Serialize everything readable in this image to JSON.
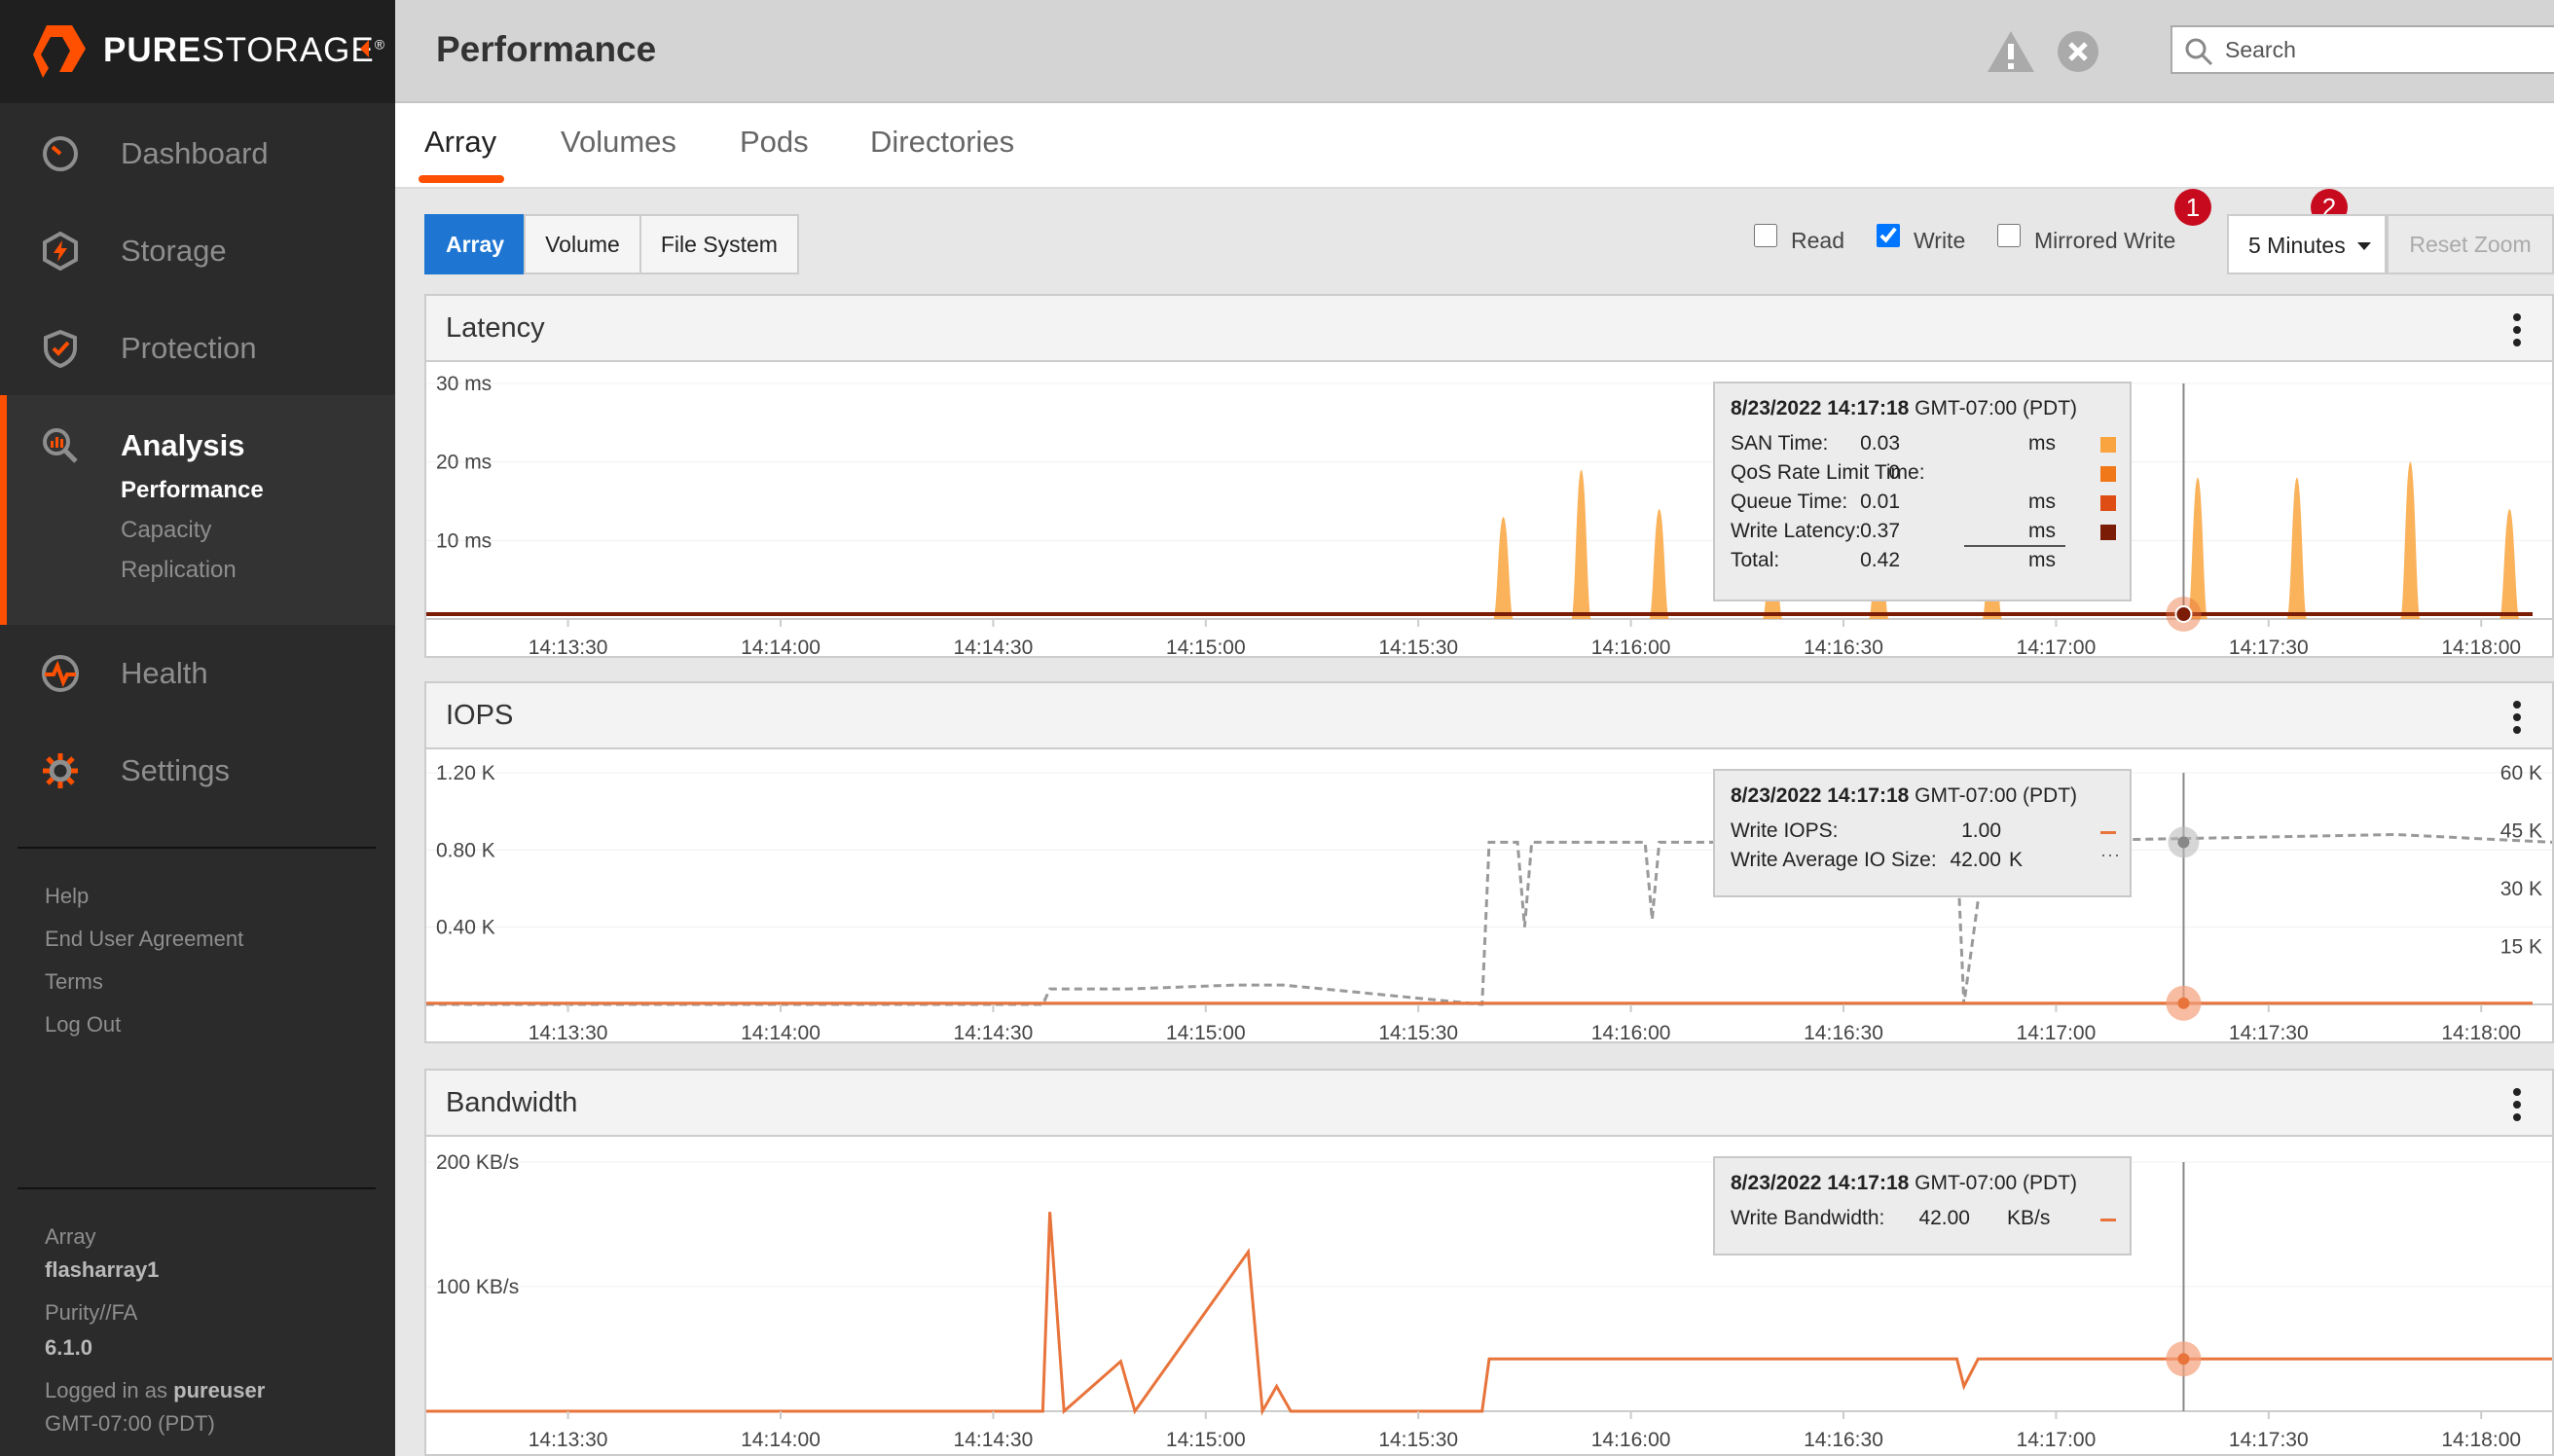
{
  "brand": {
    "name_bold": "PURE",
    "name_regular": "STORAGE",
    "mark": "®"
  },
  "sidebar": {
    "nav": {
      "dashboard": "Dashboard",
      "storage": "Storage",
      "protection": "Protection",
      "analysis": "Analysis",
      "health": "Health",
      "settings": "Settings"
    },
    "analysis_sub": {
      "performance": "Performance",
      "capacity": "Capacity",
      "replication": "Replication"
    },
    "footer_links": {
      "help": "Help",
      "eua": "End User Agreement",
      "terms": "Terms",
      "logout": "Log Out"
    },
    "info": {
      "array_label": "Array",
      "array_name": "flasharray1",
      "purity_label": "Purity//FA",
      "purity_version": "6.1.0",
      "logged_in_prefix": "Logged in as",
      "user": "pureuser",
      "timezone": "GMT-07:00 (PDT)"
    }
  },
  "header": {
    "title": "Performance",
    "search_placeholder": "Search"
  },
  "tabs": {
    "array": "Array",
    "volumes": "Volumes",
    "pods": "Pods",
    "directories": "Directories"
  },
  "toolbar": {
    "seg": {
      "array": "Array",
      "volume": "Volume",
      "filesystem": "File System"
    },
    "read_label": "Read",
    "write_label": "Write",
    "mirrored_label": "Mirrored Write",
    "badge1": "1",
    "badge2": "2",
    "read_checked": false,
    "write_checked": true,
    "mirrored_checked": false,
    "time_range": "5 Minutes",
    "reset_zoom": "Reset Zoom"
  },
  "colors": {
    "accent": "#fe5000",
    "san": "#f9a43e",
    "qos": "#f07818",
    "queue": "#dd4d14",
    "write_latency": "#7a1c06",
    "series_line": "#e8743b",
    "active_button": "#1f76d2",
    "badge": "#c80a1e"
  },
  "x_ticks": [
    "14:13:30",
    "14:14:00",
    "14:14:30",
    "14:15:00",
    "14:15:30",
    "14:16:00",
    "14:16:30",
    "14:17:00",
    "14:17:30",
    "14:18:00"
  ],
  "latency": {
    "title": "Latency",
    "y_ticks": [
      "30 ms",
      "20 ms",
      "10 ms"
    ],
    "tooltip": {
      "date": "8/23/2022 14:17:18",
      "tz": "GMT-07:00 (PDT)",
      "rows": [
        {
          "label": "SAN Time:",
          "value": "0.03",
          "unit": "ms"
        },
        {
          "label": "QoS Rate Limit Time:",
          "value": "0",
          "unit": ""
        },
        {
          "label": "Queue Time:",
          "value": "0.01",
          "unit": "ms"
        },
        {
          "label": "Write Latency:",
          "value": "0.37",
          "unit": "ms"
        },
        {
          "label": "Total:",
          "value": "0.42",
          "unit": "ms"
        }
      ]
    }
  },
  "iops": {
    "title": "IOPS",
    "y_ticks_left": [
      "1.20 K",
      "0.80 K",
      "0.40 K"
    ],
    "y_ticks_right": [
      "60 K",
      "45 K",
      "30 K",
      "15 K"
    ],
    "tooltip": {
      "date": "8/23/2022 14:17:18",
      "tz": "GMT-07:00 (PDT)",
      "rows": [
        {
          "label": "Write IOPS:",
          "value": "1.00",
          "unit": ""
        },
        {
          "label": "Write Average IO Size:",
          "value": "42.00",
          "unit": "K"
        }
      ]
    }
  },
  "bandwidth": {
    "title": "Bandwidth",
    "y_ticks": [
      "200 KB/s",
      "100 KB/s"
    ],
    "tooltip": {
      "date": "8/23/2022 14:17:18",
      "tz": "GMT-07:00 (PDT)",
      "rows": [
        {
          "label": "Write Bandwidth:",
          "value": "42.00",
          "unit": "KB/s"
        }
      ]
    }
  },
  "chart_data": [
    {
      "type": "area",
      "title": "Latency",
      "x_range": [
        "14:13:10",
        "14:18:10"
      ],
      "ylim": [
        0,
        30
      ],
      "ylabel_unit": "ms",
      "series": [
        {
          "name": "SAN Time",
          "spikes": [
            {
              "t": "14:15:42",
              "v": 13
            },
            {
              "t": "14:15:53",
              "v": 19
            },
            {
              "t": "14:16:04",
              "v": 14
            },
            {
              "t": "14:16:20",
              "v": 10
            },
            {
              "t": "14:16:35",
              "v": 12
            },
            {
              "t": "14:16:51",
              "v": 12
            },
            {
              "t": "14:17:20",
              "v": 18
            },
            {
              "t": "14:17:34",
              "v": 18
            },
            {
              "t": "14:17:50",
              "v": 20
            },
            {
              "t": "14:18:04",
              "v": 14
            }
          ]
        },
        {
          "name": "QoS Rate Limit Time",
          "values": [
            0
          ]
        },
        {
          "name": "Queue Time",
          "values": [
            0.01
          ]
        },
        {
          "name": "Write Latency",
          "baseline": 0.37
        }
      ]
    },
    {
      "type": "line",
      "title": "IOPS",
      "x_range": [
        "14:13:10",
        "14:18:10"
      ],
      "ylim": [
        0,
        1.2
      ],
      "ylim_right": [
        0,
        60
      ],
      "series": [
        {
          "name": "Write IOPS",
          "baseline": 1.0
        },
        {
          "name": "Write Average IO Size",
          "points": [
            {
              "t": "14:13:10",
              "v": 0
            },
            {
              "t": "14:14:37",
              "v": 0
            },
            {
              "t": "14:14:38",
              "v": 4
            },
            {
              "t": "14:14:49",
              "v": 4
            },
            {
              "t": "14:15:04",
              "v": 5
            },
            {
              "t": "14:15:11",
              "v": 5
            },
            {
              "t": "14:15:39",
              "v": 0
            },
            {
              "t": "14:15:40",
              "v": 42
            },
            {
              "t": "14:15:44",
              "v": 42
            },
            {
              "t": "14:15:45",
              "v": 20
            },
            {
              "t": "14:15:46",
              "v": 42
            },
            {
              "t": "14:16:02",
              "v": 42
            },
            {
              "t": "14:16:03",
              "v": 22
            },
            {
              "t": "14:16:04",
              "v": 42
            },
            {
              "t": "14:16:46",
              "v": 42
            },
            {
              "t": "14:16:47",
              "v": 0
            },
            {
              "t": "14:16:49",
              "v": 27
            },
            {
              "t": "14:16:50",
              "v": 42
            },
            {
              "t": "14:17:48",
              "v": 44
            },
            {
              "t": "14:18:10",
              "v": 42
            }
          ]
        }
      ]
    },
    {
      "type": "line",
      "title": "Bandwidth",
      "x_range": [
        "14:13:10",
        "14:18:10"
      ],
      "ylim": [
        0,
        200
      ],
      "ylabel_unit": "KB/s",
      "series": [
        {
          "name": "Write Bandwidth",
          "points": [
            {
              "t": "14:13:10",
              "v": 0
            },
            {
              "t": "14:14:37",
              "v": 0
            },
            {
              "t": "14:14:38",
              "v": 160
            },
            {
              "t": "14:14:40",
              "v": 0
            },
            {
              "t": "14:14:48",
              "v": 40
            },
            {
              "t": "14:14:50",
              "v": 0
            },
            {
              "t": "14:15:06",
              "v": 128
            },
            {
              "t": "14:15:08",
              "v": 0
            },
            {
              "t": "14:15:10",
              "v": 20
            },
            {
              "t": "14:15:12",
              "v": 0
            },
            {
              "t": "14:15:39",
              "v": 0
            },
            {
              "t": "14:15:40",
              "v": 42
            },
            {
              "t": "14:16:46",
              "v": 42
            },
            {
              "t": "14:16:47",
              "v": 20
            },
            {
              "t": "14:16:49",
              "v": 42
            },
            {
              "t": "14:18:10",
              "v": 42
            }
          ]
        }
      ]
    }
  ]
}
